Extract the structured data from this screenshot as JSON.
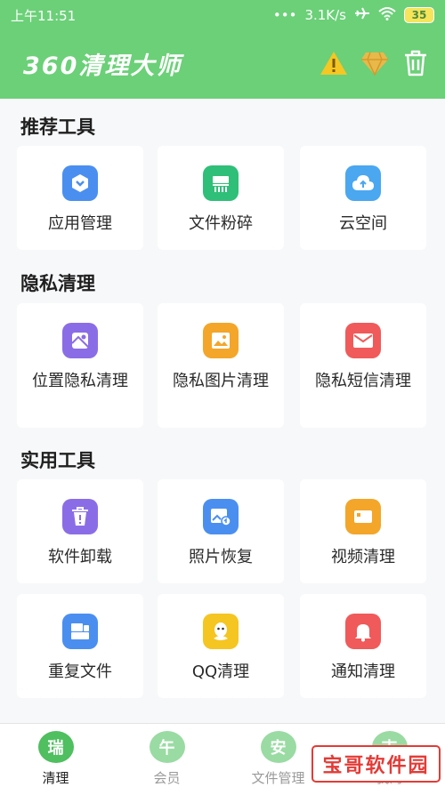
{
  "status": {
    "time": "上午11:51",
    "dots": "•••",
    "speed": "3.1K/s",
    "battery": "35"
  },
  "appbar": {
    "title": "360清理大师"
  },
  "sections": {
    "recommended": {
      "title": "推荐工具",
      "items": [
        {
          "label": "应用管理",
          "icon": "app-manage-icon",
          "color": "#4a8ff0"
        },
        {
          "label": "文件粉碎",
          "icon": "file-shred-icon",
          "color": "#2fbf78"
        },
        {
          "label": "云空间",
          "icon": "cloud-icon",
          "color": "#4aa7f0"
        }
      ]
    },
    "privacy": {
      "title": "隐私清理",
      "items": [
        {
          "label": "位置隐私清理",
          "icon": "location-privacy-icon",
          "color": "#8a6de6"
        },
        {
          "label": "隐私图片清理",
          "icon": "private-image-icon",
          "color": "#f3a629"
        },
        {
          "label": "隐私短信清理",
          "icon": "private-sms-icon",
          "color": "#f05a5a"
        }
      ]
    },
    "utility": {
      "title": "实用工具",
      "items": [
        {
          "label": "软件卸载",
          "icon": "uninstall-icon",
          "color": "#8a6de6"
        },
        {
          "label": "照片恢复",
          "icon": "photo-restore-icon",
          "color": "#4a8ff0"
        },
        {
          "label": "视频清理",
          "icon": "video-clean-icon",
          "color": "#f3a629"
        },
        {
          "label": "重复文件",
          "icon": "duplicate-file-icon",
          "color": "#4a8ff0"
        },
        {
          "label": "QQ清理",
          "icon": "qq-icon",
          "color": "#f5c521"
        },
        {
          "label": "通知清理",
          "icon": "notification-bell-icon",
          "color": "#f05a5a"
        }
      ]
    }
  },
  "nav": [
    {
      "label": "清理",
      "glyph": "瑞",
      "color": "#4fbf5f"
    },
    {
      "label": "会员",
      "glyph": "午",
      "color": "#9adba3"
    },
    {
      "label": "文件管理",
      "glyph": "安",
      "color": "#9adba3"
    },
    {
      "label": "我的",
      "glyph": "吉",
      "color": "#9adba3"
    }
  ],
  "watermark": "宝哥软件园"
}
